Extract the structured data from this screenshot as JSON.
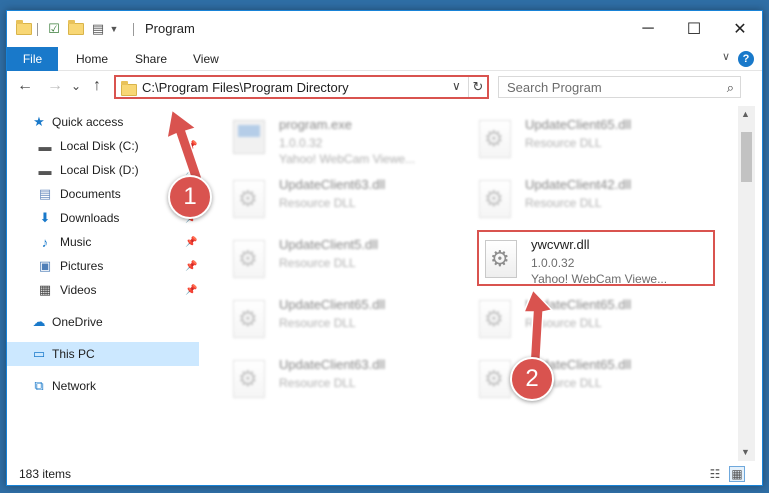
{
  "window": {
    "title": "Program",
    "controls": {
      "minimize": "─",
      "maximize": "☐",
      "close": "✕"
    }
  },
  "ribbon": {
    "tabs": [
      "File",
      "Home",
      "Share",
      "View"
    ],
    "help": "?"
  },
  "navigation": {
    "back": "←",
    "forward": "→",
    "recent": "⌄",
    "up": "↑",
    "address": "C:\\Program Files\\Program Directory",
    "search_placeholder": "Search Program"
  },
  "sidebar": {
    "items": [
      {
        "label": "Quick access",
        "icon": "star-icon"
      },
      {
        "label": "Local Disk (C:)",
        "icon": "drive-icon",
        "pinned": true
      },
      {
        "label": "Local Disk (D:)",
        "icon": "drive-icon",
        "pinned": true
      },
      {
        "label": "Documents",
        "icon": "documents-icon",
        "pinned": true
      },
      {
        "label": "Downloads",
        "icon": "downloads-icon",
        "pinned": true
      },
      {
        "label": "Music",
        "icon": "music-icon",
        "pinned": true
      },
      {
        "label": "Pictures",
        "icon": "pictures-icon",
        "pinned": true
      },
      {
        "label": "Videos",
        "icon": "videos-icon",
        "pinned": true
      },
      {
        "label": "OneDrive",
        "icon": "onedrive-icon"
      },
      {
        "label": "This PC",
        "icon": "pc-icon",
        "selected": true
      },
      {
        "label": "Network",
        "icon": "network-icon"
      }
    ]
  },
  "files": [
    {
      "name": "program.exe",
      "line2": "1.0.0.32",
      "line3": "Yahoo! WebCam Viewe...",
      "kind": "exe"
    },
    {
      "name": "UpdateClient65.dll",
      "line2": "Resource DLL",
      "line3": "",
      "kind": "dll"
    },
    {
      "name": "UpdateClient63.dll",
      "line2": "Resource DLL",
      "line3": "",
      "kind": "dll"
    },
    {
      "name": "UpdateClient42.dll",
      "line2": "Resource DLL",
      "line3": "",
      "kind": "dll"
    },
    {
      "name": "UpdateClient5.dll",
      "line2": "Resource DLL",
      "line3": "",
      "kind": "dll"
    },
    {
      "name": "ywcvwr.dll",
      "line2": "1.0.0.32",
      "line3": "Yahoo! WebCam Viewe...",
      "kind": "dll",
      "highlighted": true
    },
    {
      "name": "UpdateClient65.dll",
      "line2": "Resource DLL",
      "line3": "",
      "kind": "dll"
    },
    {
      "name": "UpdateClient65.dll",
      "line2": "Resource DLL",
      "line3": "",
      "kind": "dll"
    },
    {
      "name": "UpdateClient63.dll",
      "line2": "Resource DLL",
      "line3": "",
      "kind": "dll"
    },
    {
      "name": "UpdateClient65.dll",
      "line2": "Resource DLL",
      "line3": "",
      "kind": "dll"
    }
  ],
  "status": {
    "item_count": "183 items"
  },
  "annotations": {
    "marker1": "1",
    "marker2": "2"
  },
  "colors": {
    "accent": "#1979ca",
    "highlight": "#d9534f",
    "selected_bg": "#cce8ff"
  }
}
